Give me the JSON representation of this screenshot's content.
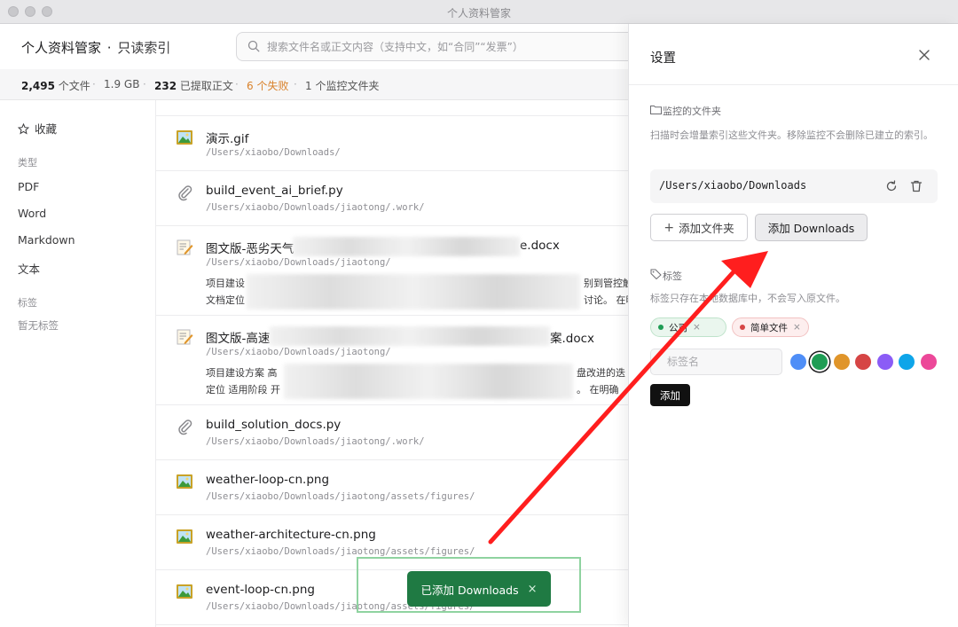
{
  "window": {
    "title": "个人资料管家"
  },
  "header": {
    "app_name": "个人资料管家",
    "separator": "·",
    "mode": "只读索引",
    "search_placeholder": "搜索文件名或正文内容（支持中文，如“合同”“发票”）"
  },
  "stats": {
    "files_count": "2,495",
    "files_label": "个文件",
    "size": "1.9 GB",
    "extracted_count": "232",
    "extracted_label": "已提取正文",
    "failed": "6 个失败",
    "watched": "1 个监控文件夹",
    "dot": "·"
  },
  "sidebar": {
    "favorites": "收藏",
    "type_heading": "类型",
    "types": [
      "PDF",
      "Word",
      "Markdown",
      "文本"
    ],
    "tags_heading": "标签",
    "no_tags": "暂无标签"
  },
  "files": [
    {
      "name": "演示.gif",
      "path": "/Users/xiaobo/Downloads/",
      "icon": "image-file-icon"
    },
    {
      "name": "build_event_ai_brief.py",
      "path": "/Users/xiaobo/Downloads/jiaotong/.work/",
      "icon": "paperclip-icon"
    },
    {
      "name_start": "图文版-恶劣天气",
      "name_end": "e.docx",
      "path": "/Users/xiaobo/Downloads/jiaotong/",
      "icon": "document-pencil-icon",
      "snippet1_start": "项目建设",
      "snippet1_end": "别到管控触",
      "snippet2_start": "文档定位",
      "snippet2_end": "讨论。 在明"
    },
    {
      "name_start": "图文版-高速",
      "name_end": "案.docx",
      "path": "/Users/xiaobo/Downloads/jiaotong/",
      "icon": "document-pencil-icon",
      "snippet1_start": "项目建设方案 高",
      "snippet1_end": "盘改进的迭",
      "snippet2_start": "定位 适用阶段 开",
      "snippet2_end": "。 在明确"
    },
    {
      "name": "build_solution_docs.py",
      "path": "/Users/xiaobo/Downloads/jiaotong/.work/",
      "icon": "paperclip-icon"
    },
    {
      "name": "weather-loop-cn.png",
      "path": "/Users/xiaobo/Downloads/jiaotong/assets/figures/",
      "icon": "image-file-icon"
    },
    {
      "name": "weather-architecture-cn.png",
      "path": "/Users/xiaobo/Downloads/jiaotong/assets/figures/",
      "icon": "image-file-icon"
    },
    {
      "name": "event-loop-cn.png",
      "path": "/Users/xiaobo/Downloads/jiaotong/assets/figures/",
      "icon": "image-file-icon"
    }
  ],
  "settings": {
    "title": "设置",
    "folders_section": "监控的文件夹",
    "folders_desc": "扫描时会增量索引这些文件夹。移除监控不会删除已建立的索引。",
    "folder_path": "/Users/xiaobo/Downloads",
    "add_folder_label": "添加文件夹",
    "add_downloads_label": "添加 Downloads",
    "tags_section": "标签",
    "tags_desc": "标签只存在本地数据库中，不会写入原文件。",
    "tags": [
      {
        "name": "公司",
        "color": "#1f9d55"
      },
      {
        "name": "简单文件",
        "color": "#d64545"
      }
    ],
    "tag_input_placeholder": "标签名",
    "swatches": [
      "#4f8ef7",
      "#1f9d55",
      "#e0952a",
      "#d64545",
      "#8b5cf6",
      "#0ea5e9",
      "#ec4899"
    ],
    "add_tag_label": "添加"
  },
  "toast": {
    "message": "已添加 Downloads",
    "close": "×"
  },
  "colors": {
    "accent_green": "#1f7a43",
    "annotation_red": "#ff1e1e",
    "warn": "#d9822b"
  }
}
